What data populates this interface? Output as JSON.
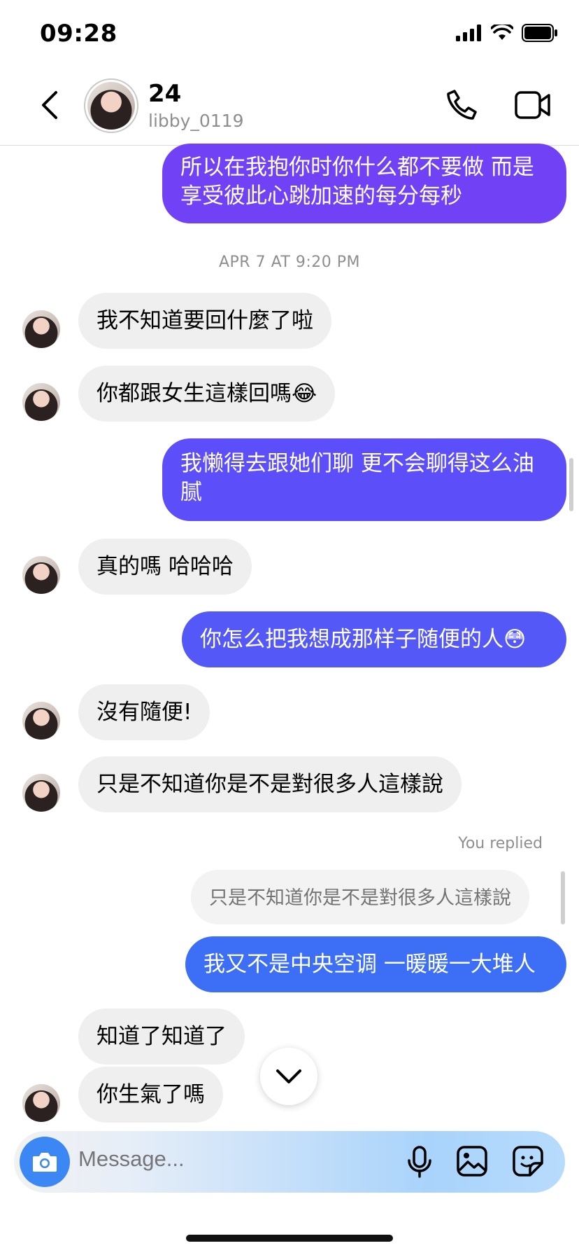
{
  "status": {
    "time": "09:28"
  },
  "header": {
    "name": "24",
    "username": "libby_0119"
  },
  "colors": {
    "out_purple": "#7142f5",
    "out_indigo": "#5c4ef8",
    "out_blue_purple": "#5358f7",
    "out_blue": "#3d6ff6",
    "in_gray": "#efefef"
  },
  "messages": [
    {
      "dir": "out",
      "text_1": "所以在我抱你时你什么都不要做 而是",
      "text_2": "享受彼此心跳加速的每分每秒"
    },
    {
      "type": "timestamp",
      "text": "APR 7 AT 9:20 PM"
    },
    {
      "dir": "in",
      "text": "我不知道要回什麼了啦"
    },
    {
      "dir": "in",
      "text": "你都跟女生這樣回嗎😂"
    },
    {
      "dir": "out",
      "text_1": "我懒得去跟她们聊 更不会聊得这么油",
      "text_2": "腻"
    },
    {
      "dir": "in",
      "text": "真的嗎 哈哈哈"
    },
    {
      "dir": "out",
      "text": "你怎么把我想成那样子随便的人😳"
    },
    {
      "dir": "in",
      "text": "沒有隨便!"
    },
    {
      "dir": "in",
      "text": "只是不知道你是不是對很多人這樣說"
    },
    {
      "type": "reply_label",
      "text": "You replied"
    },
    {
      "type": "reply_quote",
      "text": "只是不知道你是不是對很多人這樣說"
    },
    {
      "dir": "out",
      "text": "我又不是中央空调 一暖暖一大堆人"
    },
    {
      "dir": "in",
      "text": "知道了知道了"
    },
    {
      "dir": "in",
      "text": "你生氣了嗎"
    }
  ],
  "composer": {
    "placeholder": "Message..."
  },
  "icons": [
    "back-chevron-icon",
    "phone-icon",
    "video-camera-icon",
    "camera-icon",
    "microphone-icon",
    "gallery-icon",
    "sticker-icon",
    "chevron-down-icon",
    "signal-icon",
    "wifi-icon",
    "battery-icon"
  ]
}
